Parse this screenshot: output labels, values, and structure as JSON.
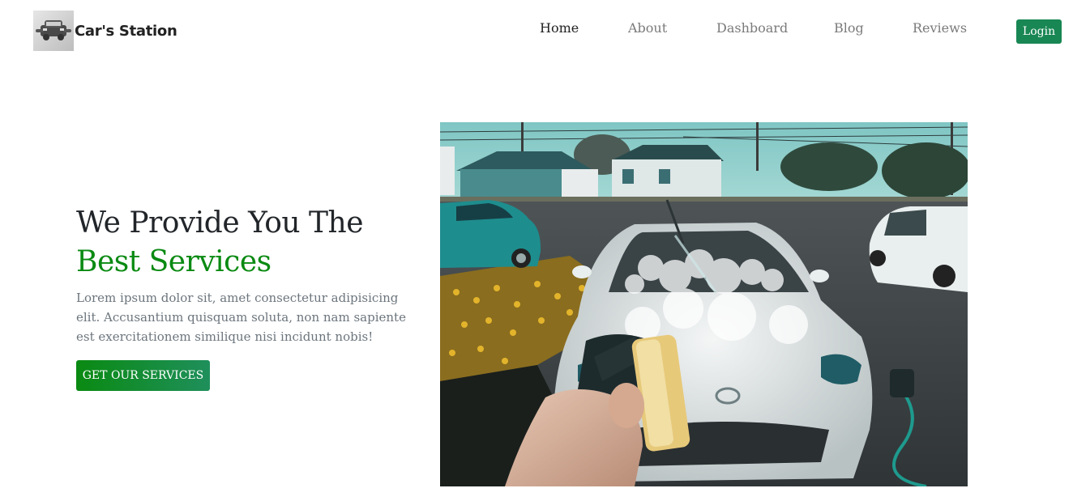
{
  "brand": {
    "name": "Car's Station",
    "logo_icon": "car-wrench-icon"
  },
  "nav": {
    "items": [
      {
        "label": "Home",
        "active": true
      },
      {
        "label": "About",
        "active": false
      },
      {
        "label": "Dashboard",
        "active": false
      },
      {
        "label": "Blog",
        "active": false
      },
      {
        "label": "Reviews",
        "active": false
      }
    ],
    "login_label": "Login"
  },
  "hero": {
    "title_line1": "We Provide You The",
    "title_line2": "Best Services",
    "description": "Lorem ipsum dolor sit, amet consectetur adipisicing elit. Accusantium quisquam soluta, non nam sapiente est exercitationem similique nisi incidunt nobis!",
    "cta_label": "GET OUR SERVICES"
  },
  "colors": {
    "accent_green": "#0a8a12",
    "login_green": "#198754",
    "nav_muted": "#7a7a7a"
  }
}
